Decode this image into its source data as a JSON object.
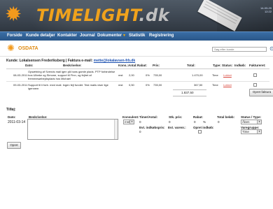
{
  "brand": {
    "title_main": "TIMELIGHT",
    "title_suffix": ".dk"
  },
  "header": {
    "info_line1": "14-03-20",
    "info_line2": "12:22"
  },
  "nav": [
    {
      "label": "Forside"
    },
    {
      "label": "Kunde detaljer"
    },
    {
      "label": "Kontakter"
    },
    {
      "label": "Journal"
    },
    {
      "label": "Dokumenter"
    },
    {
      "label": "Statistik"
    },
    {
      "label": "Registrering"
    }
  ],
  "sublogo": {
    "text": "OSDATA"
  },
  "search": {
    "placeholder": "Søg efter kunde",
    "value": "Søg efter kunde"
  },
  "customer": {
    "prefix": "Kunde: Lokalsensen Frederiksberg | Faktura e-mail: ",
    "email": "mette@lokalavsen-frb.dk"
  },
  "table": {
    "headers": {
      "date": "Dato:",
      "desc": "Beskrivelse:",
      "kons": "Kons.:",
      "antal": "Antal:",
      "rabat": "Rabat:",
      "pris": "Pris:",
      "total": "Total:",
      "type": "Type:",
      "status": "Status:",
      "indkob": "Indkøb:",
      "fakt": "Faktureret:"
    },
    "rows": [
      {
        "date": "08-03-2011",
        "desc": "Opsætning af Svends mail igen på hans gamle plads. PTP forbindelse hos Ulbeke og Simone, support til Finn, og fejlret af fremmesørbejdsplads hos Michael",
        "kons": "mst",
        "antal": "2,00",
        "rabat": "0%",
        "pris": "735,00",
        "total": "1.470,00",
        "type": "Time",
        "status": "Lukket"
      },
      {
        "date": "09-03-2011",
        "desc": "Support til li forb. med mail. Ingen fejl fundet. Test mails viser lige igennem",
        "kons": "mst",
        "antal": "0,50",
        "rabat": "0%",
        "pris": "735,00",
        "total": "367,50",
        "type": "Time",
        "status": "Lukket"
      }
    ],
    "sum": "1.837,50",
    "invoice_button": "Opret faktura"
  },
  "form": {
    "title": "Tilføj:",
    "labels": {
      "date": "Dato:",
      "desc": "Beskrivelse:",
      "kons": "Konsulent:",
      "timer": "Timer/Antal:",
      "stk": "Stk. pris:",
      "rabat": "Rabat:",
      "total": "Total beløb:",
      "status": "Status / Type:",
      "evt_ind": "Evt. indkøbspris:",
      "evt_varen": "Evt. varenr.:",
      "opret_ind": "Opret indkøb:",
      "varegruppe": "Varegruppe:"
    },
    "values": {
      "date": "2011-03-14",
      "kons": "mst",
      "timer": "0",
      "stk": "0",
      "rabat": "0",
      "pct": "%",
      "total": "0",
      "status": "Åben",
      "evt_ind": "0",
      "varegruppe": "Time"
    },
    "submit": "Opret"
  }
}
